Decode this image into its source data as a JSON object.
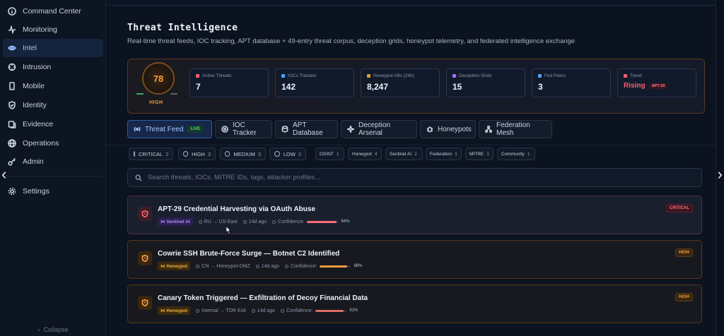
{
  "sidebar": {
    "items": [
      {
        "label": "Command Center",
        "icon": "info-icon",
        "active": false
      },
      {
        "label": "Monitoring",
        "icon": "activity-icon",
        "active": false
      },
      {
        "label": "Intel",
        "icon": "eye-icon",
        "active": true
      },
      {
        "label": "Intrusion",
        "icon": "crosshair-icon",
        "active": false
      },
      {
        "label": "Mobile",
        "icon": "phone-icon",
        "active": false
      },
      {
        "label": "Identity",
        "icon": "shield-check-icon",
        "active": false
      },
      {
        "label": "Evidence",
        "icon": "evidence-icon",
        "active": false
      },
      {
        "label": "Operations",
        "icon": "globe-icon",
        "active": false
      },
      {
        "label": "Admin",
        "icon": "key-icon",
        "active": false
      }
    ],
    "settings_label": "Settings",
    "collapse_label": "Collapse"
  },
  "page": {
    "title": "Threat Intelligence",
    "subtitle": "Real-time threat feeds, IOC tracking, APT database + 49-entry threat corpus, deception grids, honeypot telemetry, and federated intelligence exchange"
  },
  "summary": {
    "score": "78",
    "score_level": "HIGH",
    "score_level_fraction": 0.78,
    "stats": [
      {
        "label": "Active Threats",
        "value": "7",
        "color": "#ff5d6c"
      },
      {
        "label": "IOCs Tracked",
        "value": "142",
        "color": "#4aa3ff"
      },
      {
        "label": "Honeypot Hits (24h)",
        "value": "8,247",
        "color": "#e0a030"
      },
      {
        "label": "Deception Grids",
        "value": "15",
        "color": "#a070ff"
      },
      {
        "label": "Fed Peers",
        "value": "3",
        "color": "#4aa3ff"
      },
      {
        "label": "Trend",
        "value": "Rising",
        "tag": "APT-29",
        "color": "#ff5d6c"
      }
    ]
  },
  "tabs": [
    {
      "label": "Threat Feed",
      "badge": "LIVE",
      "active": true,
      "icon": "radio-icon"
    },
    {
      "label": "IOC Tracker",
      "active": false,
      "icon": "target-icon"
    },
    {
      "label": "APT Database",
      "active": false,
      "icon": "database-icon"
    },
    {
      "label": "Deception Arsenal",
      "active": false,
      "icon": "sparkle-icon"
    },
    {
      "label": "Honeypots",
      "active": false,
      "icon": "bug-icon"
    },
    {
      "label": "Federation Mesh",
      "active": false,
      "icon": "network-icon"
    }
  ],
  "severity_filters": [
    {
      "label": "CRITICAL",
      "count": "2"
    },
    {
      "label": "HIGH",
      "count": "3"
    },
    {
      "label": "MEDIUM",
      "count": "3"
    },
    {
      "label": "LOW",
      "count": "2"
    }
  ],
  "source_filters": [
    {
      "label": "OSINT",
      "count": "1"
    },
    {
      "label": "Honeypot",
      "count": "4"
    },
    {
      "label": "Sentinel AI",
      "count": "2"
    },
    {
      "label": "Federation",
      "count": "1"
    },
    {
      "label": "MITRE",
      "count": "1"
    },
    {
      "label": "Community",
      "count": "1"
    }
  ],
  "search": {
    "placeholder": "Search threats, IOCs, MITRE IDs, tags, attacker profiles..."
  },
  "threats": [
    {
      "title": "APT-29 Credential Harvesting via OAuth Abuse",
      "source": "Sentinel AI",
      "route": "RU → US-East",
      "age": "14d ago",
      "confidence_label": "Confidence:",
      "confidence": 94,
      "confidence_text": "94%",
      "severity": "CRITICAL",
      "accent": "#ff5d6c",
      "source_color": "#b48cff",
      "source_bg": "#2a2050"
    },
    {
      "title": "Cowrie SSH Brute-Force Surge — Botnet C2 Identified",
      "source": "Honeypot",
      "route": "CN → Honeypot-DMZ",
      "age": "14d ago",
      "confidence_label": "Confidence:",
      "confidence": 88,
      "confidence_text": "88%",
      "severity": "HIGH",
      "accent": "#f39a3c",
      "source_color": "#f3b03c",
      "source_bg": "#3a2a10"
    },
    {
      "title": "Canary Token Triggered — Exfiltration of Decoy Financial Data",
      "source": "Honeypot",
      "route": "Internal → TOR Exit",
      "age": "14d ago",
      "confidence_label": "Confidence:",
      "confidence": 91,
      "confidence_text": "91%",
      "severity": "HIGH",
      "accent": "#f39a3c",
      "source_color": "#f3b03c",
      "source_bg": "#3a2a10"
    }
  ]
}
